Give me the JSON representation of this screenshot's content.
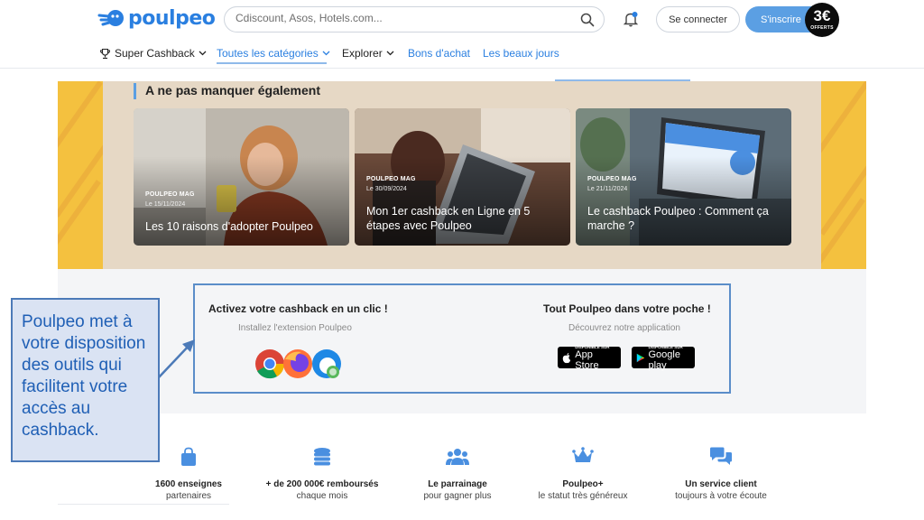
{
  "header": {
    "logo": "poulpeo",
    "search_placeholder": "Cdiscount, Asos, Hotels.com...",
    "login_label": "Se connecter",
    "signup_label": "S'inscrire",
    "badge_amount": "3€",
    "badge_text": "OFFERTS"
  },
  "nav": {
    "items": [
      "Super Cashback",
      "Toutes les catégories",
      "Explorer",
      "Bons d'achat",
      "Les beaux jours"
    ]
  },
  "mag": {
    "title": "A ne pas manquer également",
    "cards": [
      {
        "tag": "POULPEO MAG",
        "date": "Le 15/11/2024",
        "title": "Les 10 raisons d'adopter Poulpeo"
      },
      {
        "tag": "POULPEO MAG",
        "date": "Le 30/09/2024",
        "title": "Mon 1er cashback en Ligne en 5 étapes avec Poulpeo"
      },
      {
        "tag": "POULPEO MAG",
        "date": "Le 21/11/2024",
        "title": "Le cashback Poulpeo : Comment ça marche ?"
      }
    ]
  },
  "tools": {
    "extension_title": "Activez votre cashback en un clic !",
    "extension_sub": "Installez l'extension Poulpeo",
    "app_title": "Tout Poulpeo dans votre poche !",
    "app_sub": "Découvrez notre application",
    "appstore_small": "DISPONIBLE SUR",
    "appstore_big": "App Store",
    "gplay_small": "DISPONIBLE SUR",
    "gplay_big": "Google play"
  },
  "callout": {
    "text": "Poulpeo met à votre disposition des outils qui facilitent votre accès au cashback."
  },
  "features": [
    {
      "title": "1600 enseignes",
      "sub": "partenaires",
      "icon": "shopping-bag-icon"
    },
    {
      "title": "+ de 200 000€ remboursés",
      "sub": "chaque mois",
      "icon": "coins-icon"
    },
    {
      "title": "Le parrainage",
      "sub": "pour gagner plus",
      "icon": "users-icon"
    },
    {
      "title": "Poulpeo+",
      "sub": "le statut très généreux",
      "icon": "crown-icon"
    },
    {
      "title": "Un service client",
      "sub": "toujours à votre écoute",
      "icon": "chat-icon"
    }
  ],
  "colors": {
    "brand": "#2a7fe0",
    "accent_yellow": "#f4c13f",
    "callout_fill": "#dae3f3",
    "callout_border": "#4c7ab8"
  }
}
